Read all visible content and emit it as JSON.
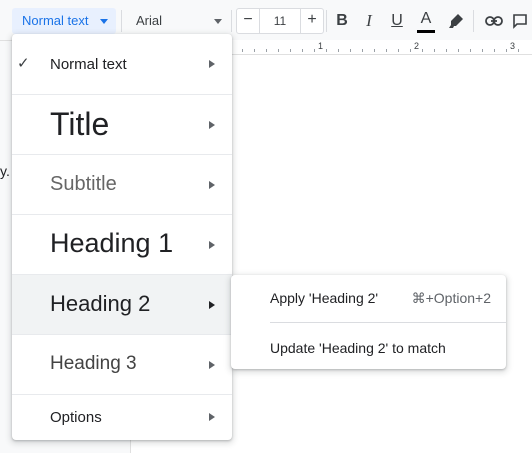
{
  "toolbar": {
    "style_select_value": "Normal text",
    "font_select_value": "Arial",
    "font_size_minus": "−",
    "font_size_value": "11",
    "font_size_plus": "+",
    "bold_label": "B",
    "italic_label": "I",
    "underline_label": "U",
    "text_color_label": "A",
    "text_color_bar": "#000000",
    "highlight_icon": "highlighter-icon",
    "link_icon": "link-icon",
    "more_icon": "more-icon"
  },
  "ruler": {
    "numbers": [
      "1",
      "2",
      "3"
    ]
  },
  "document": {
    "visible_fragment": "y."
  },
  "style_menu": {
    "items": [
      {
        "label": "Normal text",
        "checked": true
      },
      {
        "label": "Title"
      },
      {
        "label": "Subtitle"
      },
      {
        "label": "Heading 1"
      },
      {
        "label": "Heading 2",
        "highlighted": true
      },
      {
        "label": "Heading 3"
      },
      {
        "label": "Options"
      }
    ],
    "check_glyph": "✓"
  },
  "submenu": {
    "apply_label": "Apply 'Heading 2'",
    "apply_shortcut": "⌘+Option+2",
    "update_label": "Update 'Heading 2' to match"
  },
  "colors": {
    "accent": "#1a73e8",
    "selected_bg": "#e8f0fe",
    "hover_bg": "#f1f3f4"
  }
}
